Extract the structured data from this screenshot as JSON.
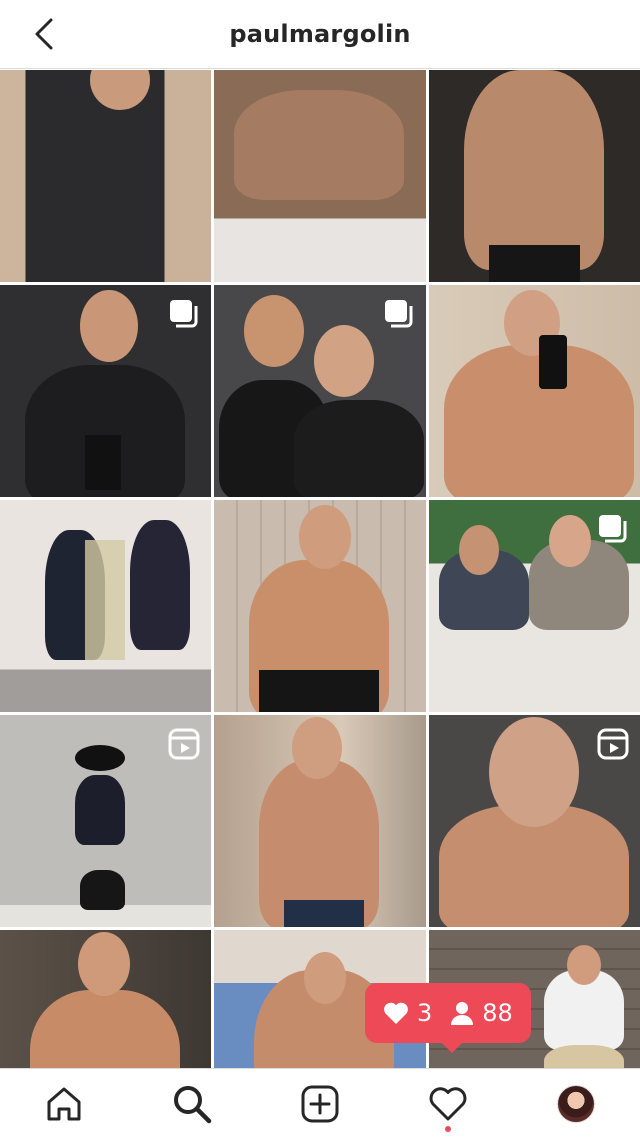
{
  "header": {
    "title": "paulmargolin"
  },
  "notification": {
    "likes": "3",
    "followers": "88"
  },
  "colors": {
    "accent": "#ed4956",
    "text": "#262626",
    "divider": "#dbdbdb"
  },
  "posts": [
    {
      "badge": "none"
    },
    {
      "badge": "none"
    },
    {
      "badge": "none"
    },
    {
      "badge": "carousel"
    },
    {
      "badge": "carousel"
    },
    {
      "badge": "none"
    },
    {
      "badge": "none"
    },
    {
      "badge": "none"
    },
    {
      "badge": "carousel"
    },
    {
      "badge": "reel"
    },
    {
      "badge": "none"
    },
    {
      "badge": "reel"
    },
    {
      "badge": "none"
    },
    {
      "badge": "none"
    },
    {
      "badge": "none"
    }
  ],
  "tabs": [
    {
      "icon": "home-icon"
    },
    {
      "icon": "search-icon",
      "active": true
    },
    {
      "icon": "new-post-icon"
    },
    {
      "icon": "activity-heart-icon"
    },
    {
      "icon": "profile-avatar"
    }
  ]
}
